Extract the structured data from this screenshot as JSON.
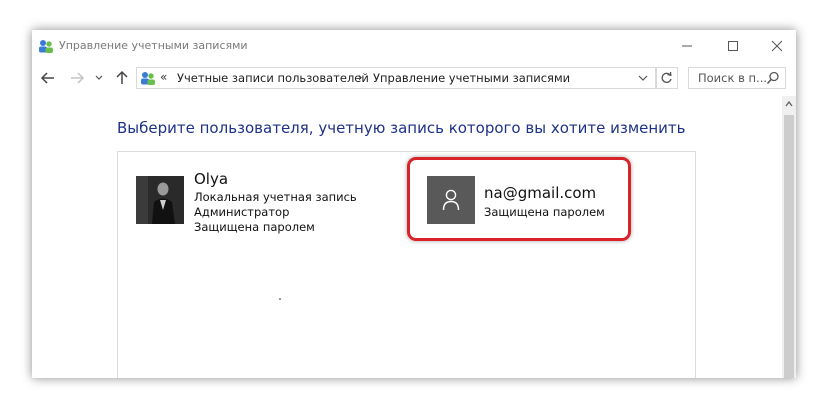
{
  "window": {
    "title": "Управление учетными записями",
    "title_icon": "user-accounts-icon",
    "controls": [
      "minimize-icon",
      "maximize-icon",
      "close-icon"
    ]
  },
  "navigation": {
    "icons": [
      "back-arrow-icon",
      "forward-arrow-icon",
      "recent-locations-icon",
      "up-arrow-icon"
    ]
  },
  "address": {
    "overflow": "«",
    "separator": "›",
    "crumbs": [
      "Учетные записи пользователей",
      "Управление учетными записями"
    ]
  },
  "search": {
    "placeholder": "Поиск в п..."
  },
  "heading": "Выберите пользователя, учетную запись которого вы хотите изменить",
  "accounts": [
    {
      "name": "Olya",
      "details": [
        "Локальная учетная запись",
        "Администратор",
        "Защищена паролем"
      ],
      "avatar": "user-photo"
    },
    {
      "name": "na@gmail.com",
      "details": [
        "Защищена паролем"
      ],
      "avatar": "default-user-icon",
      "highlighted": true
    }
  ],
  "colors": {
    "heading": "#1e3287",
    "highlight_border": "#d8232a",
    "default_avatar_bg": "#595959"
  }
}
